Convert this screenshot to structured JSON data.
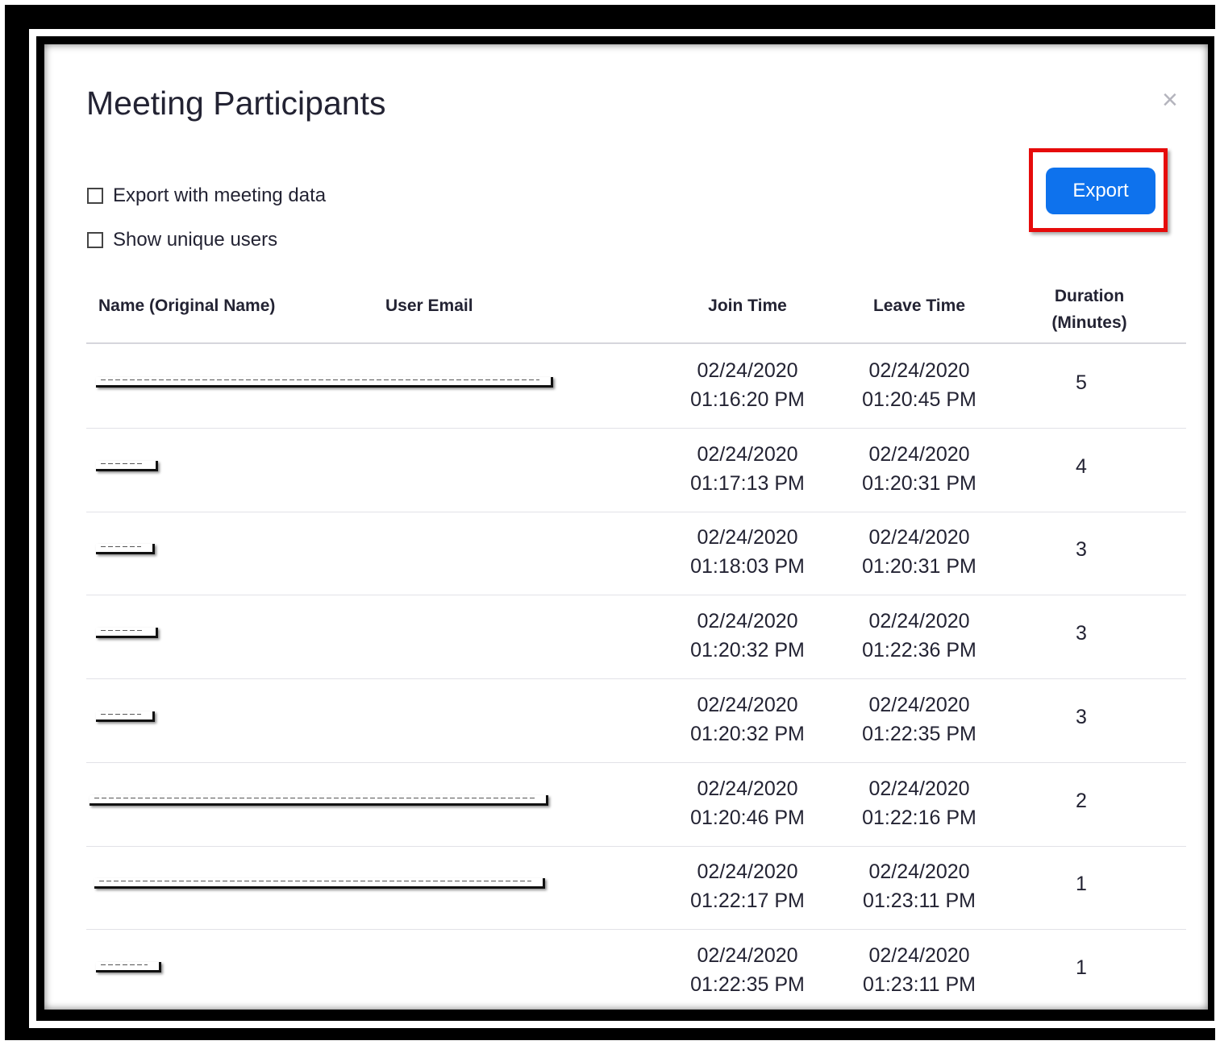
{
  "dialog": {
    "title": "Meeting Participants",
    "close_symbol": "×",
    "options": {
      "export_with_meeting_data": {
        "label": "Export with meeting data",
        "checked": false
      },
      "show_unique_users": {
        "label": "Show unique users",
        "checked": false
      }
    },
    "export_label": "Export",
    "colors": {
      "accent": "#0e72ed",
      "highlight": "#e60b0b"
    }
  },
  "table": {
    "headers": {
      "name": "Name (Original Name)",
      "email": "User Email",
      "join": "Join Time",
      "leave": "Leave Time",
      "duration_line1": "Duration",
      "duration_line2": "(Minutes)"
    },
    "rows": [
      {
        "join_date": "02/24/2020",
        "join_time": "01:16:20 PM",
        "leave_date": "02/24/2020",
        "leave_time": "01:20:45 PM",
        "duration": "5"
      },
      {
        "join_date": "02/24/2020",
        "join_time": "01:17:13 PM",
        "leave_date": "02/24/2020",
        "leave_time": "01:20:31 PM",
        "duration": "4"
      },
      {
        "join_date": "02/24/2020",
        "join_time": "01:18:03 PM",
        "leave_date": "02/24/2020",
        "leave_time": "01:20:31 PM",
        "duration": "3"
      },
      {
        "join_date": "02/24/2020",
        "join_time": "01:20:32 PM",
        "leave_date": "02/24/2020",
        "leave_time": "01:22:36 PM",
        "duration": "3"
      },
      {
        "join_date": "02/24/2020",
        "join_time": "01:20:32 PM",
        "leave_date": "02/24/2020",
        "leave_time": "01:22:35 PM",
        "duration": "3"
      },
      {
        "join_date": "02/24/2020",
        "join_time": "01:20:46 PM",
        "leave_date": "02/24/2020",
        "leave_time": "01:22:16 PM",
        "duration": "2"
      },
      {
        "join_date": "02/24/2020",
        "join_time": "01:22:17 PM",
        "leave_date": "02/24/2020",
        "leave_time": "01:23:11 PM",
        "duration": "1"
      },
      {
        "join_date": "02/24/2020",
        "join_time": "01:22:35 PM",
        "leave_date": "02/24/2020",
        "leave_time": "01:23:11 PM",
        "duration": "1"
      }
    ]
  }
}
